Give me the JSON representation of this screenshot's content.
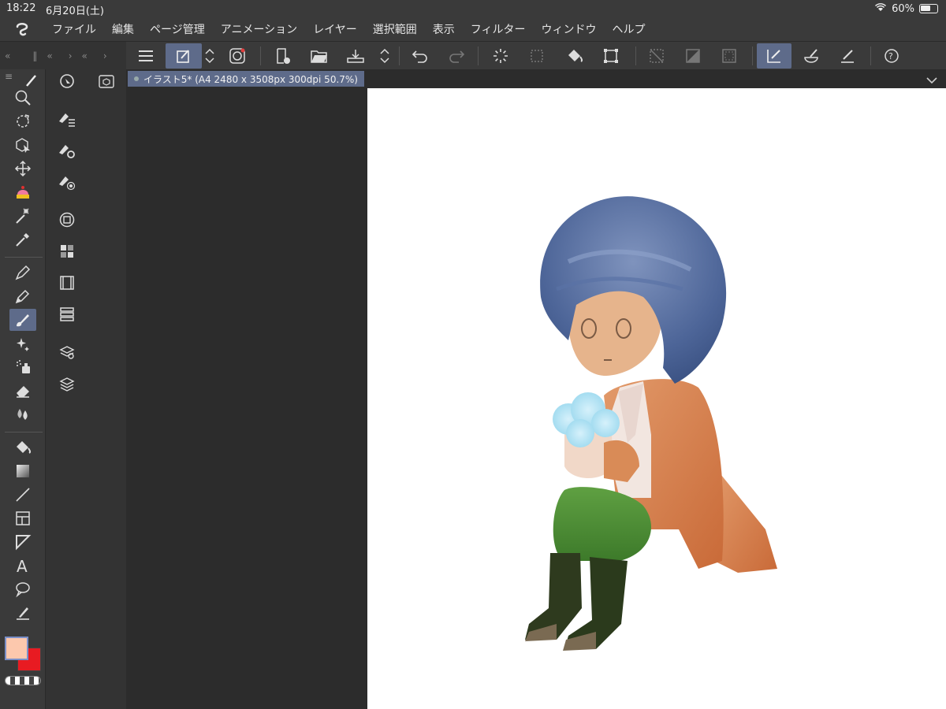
{
  "status": {
    "time": "18:22",
    "date": "6月20日(土)",
    "battery": "60%"
  },
  "menu": [
    "ファイル",
    "編集",
    "ページ管理",
    "アニメーション",
    "レイヤー",
    "選択範囲",
    "表示",
    "フィルター",
    "ウィンドウ",
    "ヘルプ"
  ],
  "document": {
    "tab_label": "イラスト5* (A4 2480 x 3508px 300dpi 50.7%)"
  },
  "colors": {
    "main": "#fcc8ad",
    "sub": "#e81b22",
    "active_bg": "#5e6b8a"
  },
  "toolbar_icons": [
    "menu-icon",
    "pen-settings-icon",
    "stepper-icon",
    "spiral-icon",
    "new-file-icon",
    "open-folder-icon",
    "save-icon",
    "stepper-icon",
    "undo-icon",
    "redo-icon",
    "loading-icon",
    "selection-icon",
    "fill-icon",
    "transform-icon",
    "deselect-icon",
    "invert-selection-icon",
    "selection-border-icon",
    "pen-snap-icon",
    "blend-icon",
    "ruler-pen-icon",
    "help-icon"
  ],
  "tool_icons": [
    "zoom-icon",
    "rotate-icon",
    "object-select-icon",
    "move-icon",
    "cake-icon",
    "auto-select-icon",
    "eyedropper-icon",
    "pen-icon",
    "pencil-icon",
    "brush-icon",
    "airbrush-icon",
    "decoration-icon",
    "eraser-icon",
    "blend-icon",
    "fill-icon",
    "gradient-icon",
    "line-icon",
    "frame-icon",
    "ruler-icon",
    "text-icon",
    "balloon-icon",
    "correction-line-icon"
  ]
}
